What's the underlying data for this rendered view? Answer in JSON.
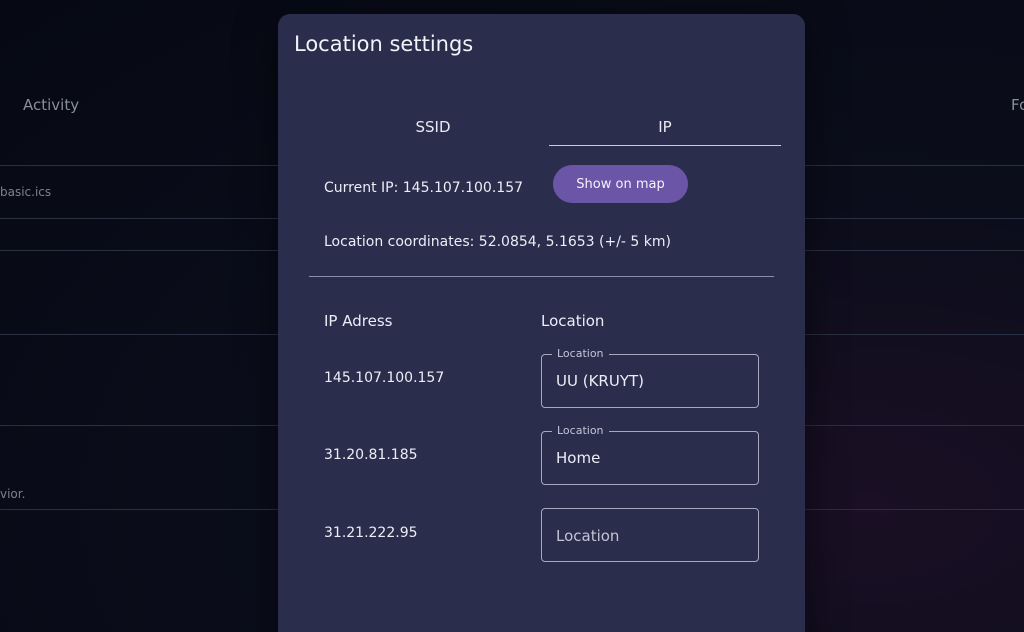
{
  "background": {
    "header_left": "Activity",
    "header_right": "Fo",
    "cell_file": "basic.ics",
    "cell_snippet": "vior."
  },
  "dialog": {
    "title": "Location settings",
    "tabs": [
      {
        "label": "SSID",
        "active": false
      },
      {
        "label": "IP",
        "active": true
      }
    ],
    "current_ip_text": "Current IP: 145.107.100.157",
    "show_on_map_label": "Show on map",
    "coordinates_text": "Location coordinates: 52.0854, 5.1653 (+/- 5 km)",
    "table": {
      "header_ip": "IP Adress",
      "header_location": "Location",
      "rows": [
        {
          "ip": "145.107.100.157",
          "location_label": "Location",
          "location_value": "UU (KRUYT)",
          "placeholder": "Location"
        },
        {
          "ip": "31.20.81.185",
          "location_label": "Location",
          "location_value": "Home",
          "placeholder": "Location"
        },
        {
          "ip": "31.21.222.95",
          "location_label": "",
          "location_value": "",
          "placeholder": "Location"
        }
      ]
    }
  },
  "colors": {
    "dialog_bg": "#2a2d4b",
    "button_bg": "#6a55a7",
    "page_bg": "#060913"
  }
}
